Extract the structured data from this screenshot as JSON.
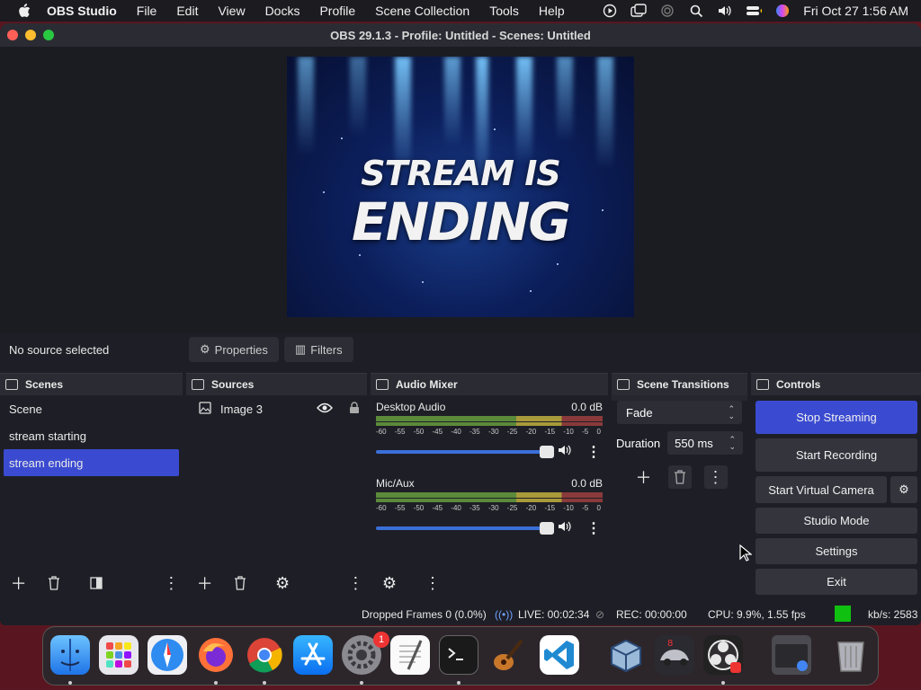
{
  "menubar": {
    "app_name": "OBS Studio",
    "items": [
      "File",
      "Edit",
      "View",
      "Docks",
      "Profile",
      "Scene Collection",
      "Tools",
      "Help"
    ],
    "clock": "Fri Oct 27  1:56 AM"
  },
  "window": {
    "title": "OBS 29.1.3 - Profile: Untitled - Scenes: Untitled"
  },
  "preview": {
    "line1": "STREAM IS",
    "line2": "ENDING"
  },
  "source_bar": {
    "status": "No source selected",
    "properties_label": "Properties",
    "filters_label": "Filters"
  },
  "scenes": {
    "title": "Scenes",
    "items": [
      "Scene",
      "stream starting",
      "stream ending"
    ],
    "selected_index": 2
  },
  "sources": {
    "title": "Sources",
    "items": [
      "Image 3"
    ]
  },
  "audio_mixer": {
    "title": "Audio Mixer",
    "channels": [
      {
        "name": "Desktop Audio",
        "level": "0.0 dB",
        "volume": 0.97
      },
      {
        "name": "Mic/Aux",
        "level": "0.0 dB",
        "volume": 0.97
      }
    ],
    "ticks": [
      "-60",
      "-55",
      "-50",
      "-45",
      "-40",
      "-35",
      "-30",
      "-25",
      "-20",
      "-15",
      "-10",
      "-5",
      "0"
    ]
  },
  "transitions": {
    "title": "Scene Transitions",
    "selected": "Fade",
    "duration_label": "Duration",
    "duration_value": "550 ms"
  },
  "controls": {
    "title": "Controls",
    "stop_streaming": "Stop Streaming",
    "start_recording": "Start Recording",
    "start_virtual_camera": "Start Virtual Camera",
    "studio_mode": "Studio Mode",
    "settings": "Settings",
    "exit": "Exit"
  },
  "status": {
    "dropped_frames": "Dropped Frames 0 (0.0%)",
    "live": "LIVE: 00:02:34",
    "rec": "REC: 00:00:00",
    "cpu": "CPU: 9.9%, 1.55 fps",
    "kbs": "kb/s: 2583",
    "stream_health_color": "#10c010"
  },
  "dock_apps": [
    {
      "name": "Finder",
      "icon": "finder-icon"
    },
    {
      "name": "Launchpad",
      "icon": "launchpad-icon"
    },
    {
      "name": "Safari",
      "icon": "safari-icon"
    },
    {
      "name": "Firefox",
      "icon": "firefox-icon"
    },
    {
      "name": "Chrome",
      "icon": "chrome-icon"
    },
    {
      "name": "App Store",
      "icon": "appstore-icon"
    },
    {
      "name": "System Settings",
      "icon": "settings-icon",
      "badge": "1"
    },
    {
      "name": "TextEdit",
      "icon": "textedit-icon"
    },
    {
      "name": "Terminal",
      "icon": "terminal-icon"
    },
    {
      "name": "GarageBand",
      "icon": "guitar-icon"
    },
    {
      "name": "VS Code",
      "icon": "vscode-icon"
    },
    {
      "name": "VirtualBox",
      "icon": "virtualbox-icon"
    },
    {
      "name": "Racing Game",
      "icon": "car-icon"
    },
    {
      "name": "OBS",
      "icon": "obs-icon"
    },
    {
      "name": "Folder",
      "icon": "folder-icon"
    },
    {
      "name": "Trash",
      "icon": "trash-icon"
    }
  ]
}
